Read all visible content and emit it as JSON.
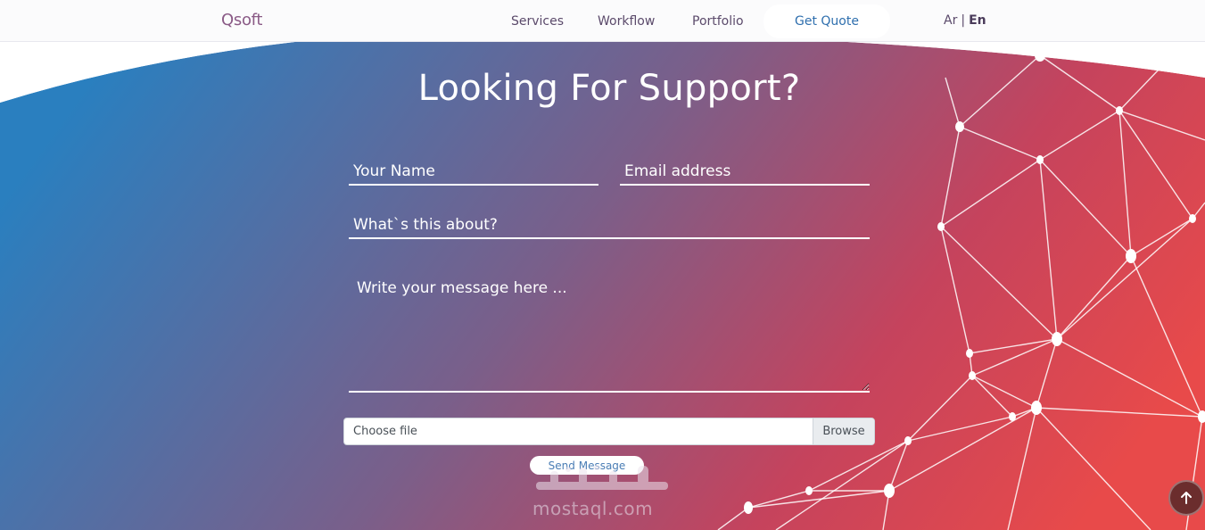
{
  "nav": {
    "brand": "Qsoft",
    "links": [
      "Services",
      "Workflow",
      "Portfolio"
    ],
    "cta": "Get Quote",
    "lang_ar": "Ar",
    "lang_sep": "|",
    "lang_en": "En"
  },
  "hero": {
    "title": "Looking For Support?"
  },
  "form": {
    "name_placeholder": "Your Name",
    "email_placeholder": "Email address",
    "about_placeholder": "What`s this about?",
    "message_placeholder": "Write your message here ...",
    "file_label": "Choose file",
    "browse_label": "Browse",
    "send_label": "Send Message"
  },
  "watermark": {
    "text": "mostaql.com"
  },
  "colors": {
    "gradient_start": "#2a7fbf",
    "gradient_mid": "#7a5f8a",
    "gradient_end": "#e84a4a",
    "accent_link": "#2f6fae"
  },
  "icons": {
    "scroll_top": "arrow-up-icon"
  }
}
